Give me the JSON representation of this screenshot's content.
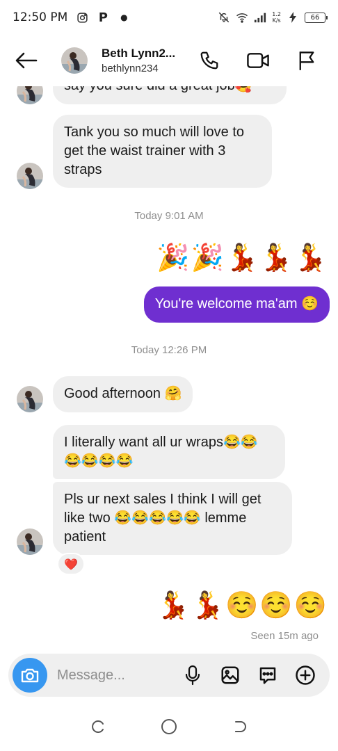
{
  "status_bar": {
    "time": "12:50 PM",
    "net_speed_top": "1.2",
    "net_speed_bottom": "K/s",
    "battery": "66"
  },
  "header": {
    "name": "Beth Lynn2...",
    "username": "bethlynn234"
  },
  "messages": {
    "m0_partial": "say you sure did a great job🥰",
    "m1": "Tank you so much will love to get the waist trainer with 3 straps",
    "ts1": "Today 9:01 AM",
    "emoji_row1": "🎉🎉💃💃💃",
    "sent1": "You're welcome ma'am ☺️",
    "ts2": "Today 12:26 PM",
    "m2": "Good afternoon 🤗",
    "m3": "I literally want all ur wraps😂😂😂😂😂😂",
    "m4": "Pls ur next sales I think I will get like two 😂😂😂😂😂 lemme patient",
    "reaction": "❤️",
    "emoji_row2": "💃💃☺️☺️☺️",
    "seen": "Seen 15m ago"
  },
  "composer": {
    "placeholder": "Message..."
  },
  "colors": {
    "sent_bubble": "#6f2fd0",
    "received_bubble": "#efefef",
    "camera_button": "#3797f0"
  }
}
